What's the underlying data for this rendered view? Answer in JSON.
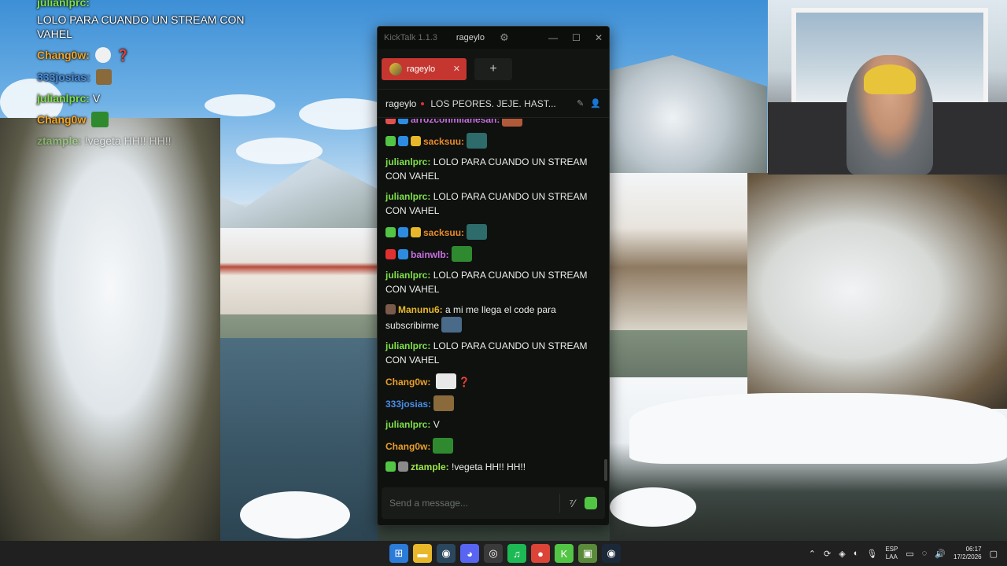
{
  "overlay": {
    "lines": [
      {
        "user": "julianlprc:",
        "text": "LOLO PARA CUANDO UN STREAM CON VAHEL",
        "user_color": "#7fe04a"
      },
      {
        "user": "Chang0w:",
        "text": "❓",
        "user_color": "#f5a623"
      },
      {
        "user": "333josias:",
        "text": "",
        "user_color": "#4a90e2"
      },
      {
        "user": "julianlprc:",
        "text": "V",
        "user_color": "#7fe04a"
      },
      {
        "user": "Chang0w",
        "text": "",
        "user_color": "#f5a623"
      },
      {
        "user": "ztample:",
        "text": "!vegeta HH!! HH!!",
        "user_color": "#7fe04a"
      }
    ]
  },
  "app": {
    "name": "KickTalk 1.1.3",
    "username": "rageylo",
    "window_buttons": [
      "—",
      "☐",
      "✕"
    ]
  },
  "tabs": [
    {
      "label": "rageylo",
      "close": "✕"
    }
  ],
  "add_tab": "+",
  "channel": {
    "name": "rageylo",
    "title": "LOS PEORES. JEJE. HAST..."
  },
  "messages": [
    {
      "user": "arrozconmilanesah:",
      "text": "",
      "color": "#c86fe0",
      "badges": [
        "#e05050",
        "#2d8ce0"
      ],
      "emote": "#b05a3a"
    },
    {
      "user": "sacksuu:",
      "text": "",
      "color": "#e88a2a",
      "badges": [
        "#53c545",
        "#2d8ce0",
        "#e8b82a"
      ],
      "emote": "#2e6b6b"
    },
    {
      "user": "julianlprc:",
      "text": "LOLO PARA CUANDO UN STREAM CON VAHEL",
      "color": "#7fe04a",
      "badges": [],
      "emote": ""
    },
    {
      "user": "julianlprc:",
      "text": "LOLO PARA CUANDO UN STREAM CON VAHEL",
      "color": "#7fe04a",
      "badges": [],
      "emote": ""
    },
    {
      "user": "sacksuu:",
      "text": "",
      "color": "#e88a2a",
      "badges": [
        "#53c545",
        "#2d8ce0",
        "#e8b82a"
      ],
      "emote": "#2e6b6b"
    },
    {
      "user": "bainwlb:",
      "text": "",
      "color": "#c86fe0",
      "badges": [
        "#e03030",
        "#2d8ce0"
      ],
      "emote": "#2f8a2f"
    },
    {
      "user": "julianlprc:",
      "text": "LOLO PARA CUANDO UN STREAM CON VAHEL",
      "color": "#7fe04a",
      "badges": [],
      "emote": ""
    },
    {
      "user": "Manunu6:",
      "text": "a mi me llega el code para subscribirme",
      "color": "#e8b82a",
      "badges": [
        "#7a5a4a"
      ],
      "emote": "#4a6a8a"
    },
    {
      "user": "julianlprc:",
      "text": "LOLO PARA CUANDO UN STREAM CON VAHEL",
      "color": "#7fe04a",
      "badges": [],
      "emote": ""
    },
    {
      "user": "Chang0w:",
      "text": "❓",
      "color": "#e8a02a",
      "badges": [],
      "emote": "#e8e8e8"
    },
    {
      "user": "333josias:",
      "text": "",
      "color": "#4a8ee8",
      "badges": [],
      "emote": "#8a6a3a"
    },
    {
      "user": "julianlprc:",
      "text": "V",
      "color": "#7fe04a",
      "badges": [],
      "emote": ""
    },
    {
      "user": "Chang0w:",
      "text": "",
      "color": "#e8a02a",
      "badges": [],
      "emote": "#2f8a2f"
    },
    {
      "user": "ztample:",
      "text": "!vegeta HH!! HH!!",
      "color": "#9ee84a",
      "badges": [
        "#53c545",
        "#8a8a8a"
      ],
      "emote": ""
    }
  ],
  "input": {
    "placeholder": "Send a message...",
    "translate_icon": "translate-icon",
    "emote_icon": "emote-picker-icon"
  },
  "taskbar": {
    "language": [
      "ESP",
      "LAA"
    ],
    "time": "06:17",
    "date": "17/2/2026"
  }
}
